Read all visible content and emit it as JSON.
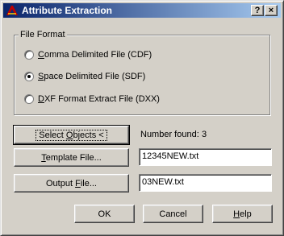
{
  "window": {
    "title": "Attribute Extraction",
    "help_button": "?",
    "close_button": "×"
  },
  "file_format": {
    "legend": "File Format",
    "options": [
      {
        "pre": "",
        "ul": "C",
        "post": "omma Delimited File (CDF)",
        "checked": false
      },
      {
        "pre": "",
        "ul": "S",
        "post": "pace Delimited File (SDF)",
        "checked": true
      },
      {
        "pre": "",
        "ul": "D",
        "post": "XF Format Extract File (DXX)",
        "checked": false
      }
    ]
  },
  "select_objects": {
    "pre": "Select ",
    "ul": "O",
    "post": "bjects <"
  },
  "number_found": {
    "label": "Number found:",
    "value": "3"
  },
  "template_file": {
    "pre": "",
    "ul": "T",
    "post": "emplate File...",
    "value": "12345NEW.txt"
  },
  "output_file": {
    "pre": "Output ",
    "ul": "F",
    "post": "ile...",
    "value": "03NEW.txt"
  },
  "buttons": {
    "ok": "OK",
    "cancel": "Cancel",
    "help_pre": "",
    "help_ul": "H",
    "help_post": "elp"
  }
}
